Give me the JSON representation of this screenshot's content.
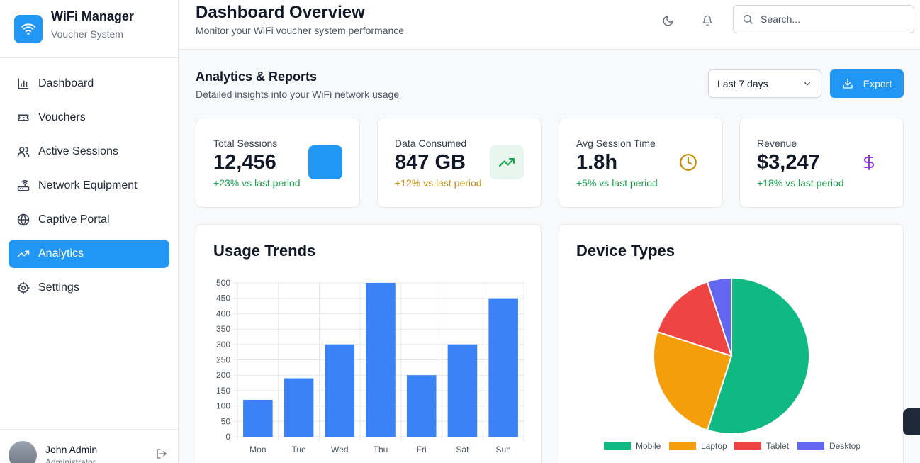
{
  "brand": {
    "title": "WiFi Manager",
    "subtitle": "Voucher System"
  },
  "sidebar": {
    "items": [
      {
        "label": "Dashboard",
        "icon": "bar-chart-icon",
        "active": false
      },
      {
        "label": "Vouchers",
        "icon": "ticket-icon",
        "active": false
      },
      {
        "label": "Active Sessions",
        "icon": "users-icon",
        "active": false
      },
      {
        "label": "Network Equipment",
        "icon": "router-icon",
        "active": false
      },
      {
        "label": "Captive Portal",
        "icon": "globe-icon",
        "active": false
      },
      {
        "label": "Analytics",
        "icon": "trending-up-icon",
        "active": true
      },
      {
        "label": "Settings",
        "icon": "gear-icon",
        "active": false
      }
    ]
  },
  "user": {
    "name": "John Admin",
    "role": "Administrator"
  },
  "header": {
    "title": "Dashboard Overview",
    "subtitle": "Monitor your WiFi voucher system performance",
    "search_placeholder": "Search..."
  },
  "section": {
    "title": "Analytics & Reports",
    "subtitle": "Detailed insights into your WiFi network usage",
    "range_selected": "Last 7 days",
    "export_label": "Export"
  },
  "stats": [
    {
      "label": "Total Sessions",
      "value": "12,456",
      "change": "+23% vs last period",
      "change_color": "#16a34a"
    },
    {
      "label": "Data Consumed",
      "value": "847 GB",
      "change": "+12% vs last period",
      "change_color": "#ca8a04"
    },
    {
      "label": "Avg Session Time",
      "value": "1.8h",
      "change": "+5% vs last period",
      "change_color": "#16a34a"
    },
    {
      "label": "Revenue",
      "value": "$3,247",
      "change": "+18% vs last period",
      "change_color": "#16a34a"
    }
  ],
  "colors": {
    "accent": "#2196f3",
    "bar": "#3b82f6"
  },
  "chart_data": [
    {
      "type": "bar",
      "title": "Usage Trends",
      "categories": [
        "Mon",
        "Tue",
        "Wed",
        "Thu",
        "Fri",
        "Sat",
        "Sun"
      ],
      "values": [
        120,
        190,
        300,
        500,
        200,
        300,
        450
      ],
      "ylim": [
        0,
        500
      ],
      "yticks": [
        0,
        50,
        100,
        150,
        200,
        250,
        300,
        350,
        400,
        450,
        500
      ],
      "grid": true,
      "color": "#3b82f6"
    },
    {
      "type": "pie",
      "title": "Device Types",
      "labels": [
        "Mobile",
        "Laptop",
        "Tablet",
        "Desktop"
      ],
      "values": [
        55,
        25,
        15,
        5
      ],
      "colors": [
        "#10b981",
        "#f59e0b",
        "#ef4444",
        "#6366f1"
      ],
      "legend": "bottom"
    }
  ]
}
